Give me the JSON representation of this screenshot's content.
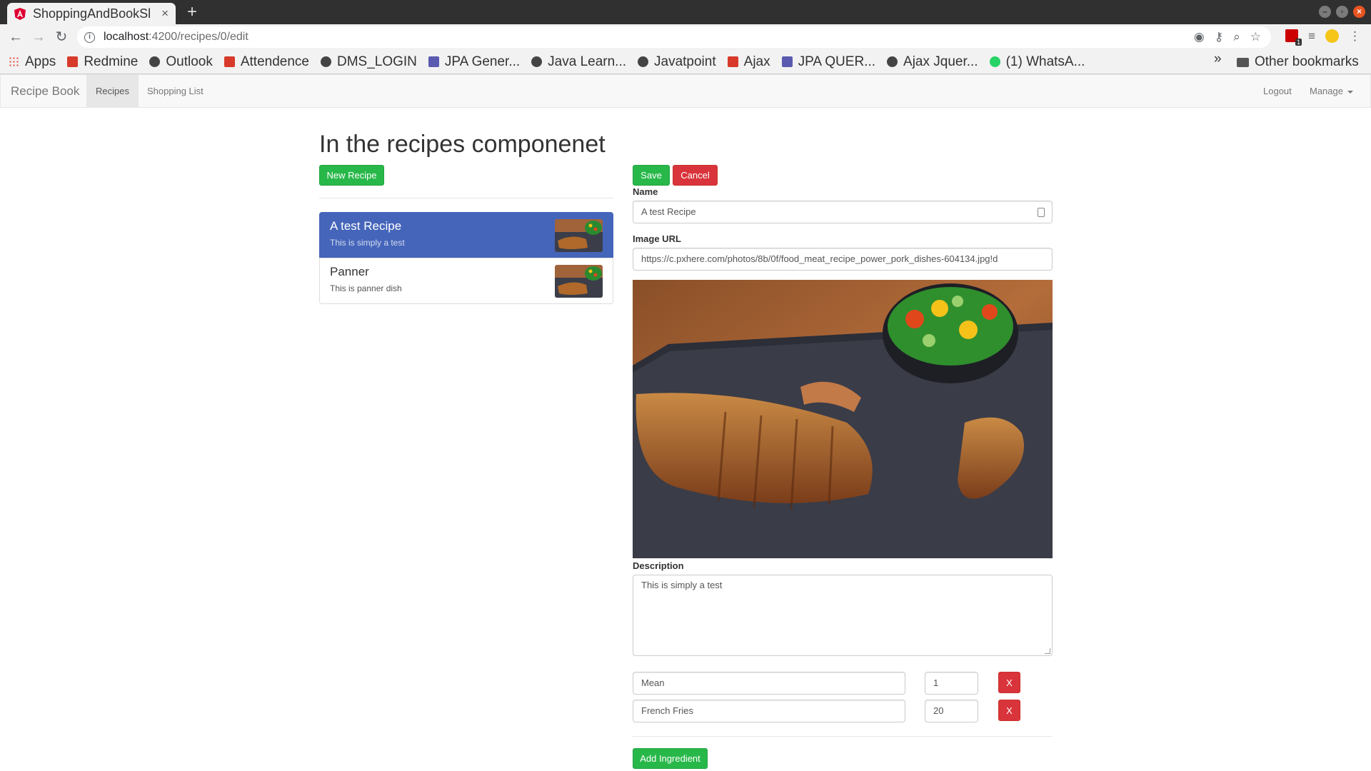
{
  "browser": {
    "tab_title": "ShoppingAndBookSl",
    "tab_close": "×",
    "new_tab": "+",
    "url_host": "localhost",
    "url_path": ":4200/recipes/0/edit",
    "window_buttons": [
      "–",
      "▫",
      "×"
    ]
  },
  "bookmarks": {
    "items": [
      {
        "label": "Apps",
        "icon": "apps-grid-icon"
      },
      {
        "label": "Redmine",
        "icon": "redmine-icon"
      },
      {
        "label": "Outlook",
        "icon": "globe-icon"
      },
      {
        "label": "Attendence",
        "icon": "attendence-icon"
      },
      {
        "label": "DMS_LOGIN",
        "icon": "globe-icon"
      },
      {
        "label": "JPA Gener...",
        "icon": "page-icon"
      },
      {
        "label": "Java Learn...",
        "icon": "globe-icon"
      },
      {
        "label": "Javatpoint",
        "icon": "globe-icon"
      },
      {
        "label": "Ajax",
        "icon": "ajax-icon"
      },
      {
        "label": "JPA QUER...",
        "icon": "page-icon"
      },
      {
        "label": "Ajax Jquer...",
        "icon": "globe-icon"
      },
      {
        "label": "(1) WhatsA...",
        "icon": "whatsapp-icon"
      }
    ],
    "more": "»",
    "other": "Other bookmarks"
  },
  "navbar": {
    "brand": "Recipe Book",
    "recipes": "Recipes",
    "shopping_list": "Shopping List",
    "logout": "Logout",
    "manage": "Manage"
  },
  "page": {
    "title": "In the recipes componenet",
    "new_recipe": "New Recipe"
  },
  "recipes": [
    {
      "name": "A test Recipe",
      "description": "This is simply a test",
      "active": true
    },
    {
      "name": "Panner",
      "description": "This is panner dish",
      "active": false
    }
  ],
  "form": {
    "save": "Save",
    "cancel": "Cancel",
    "name_label": "Name",
    "name_value": "A test Recipe",
    "image_url_label": "Image URL",
    "image_url_value": "https://c.pxhere.com/photos/8b/0f/food_meat_recipe_power_pork_dishes-604134.jpg!d",
    "description_label": "Description",
    "description_value": "This is simply a test",
    "ingredients": [
      {
        "name": "Mean",
        "amount": "1",
        "remove": "X"
      },
      {
        "name": "French Fries",
        "amount": "20",
        "remove": "X"
      }
    ],
    "add_ingredient": "Add Ingredient"
  },
  "colors": {
    "success": "#28b84a",
    "danger": "#d9343b",
    "active_item": "#4565ba"
  }
}
